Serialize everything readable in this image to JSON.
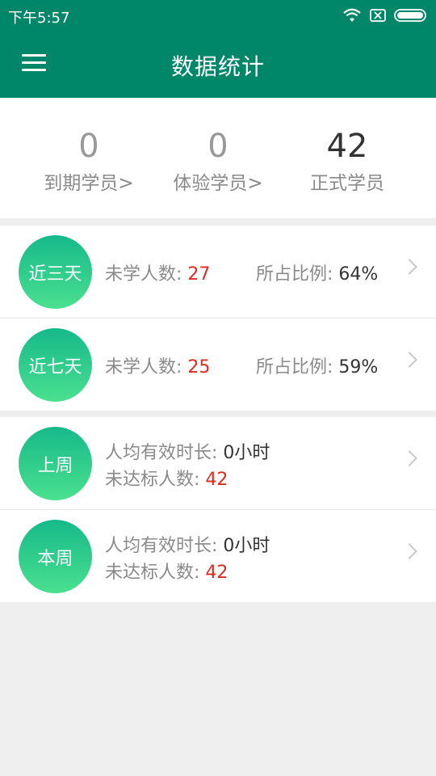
{
  "status_bar": {
    "time": "下午5:57",
    "icons": [
      "wifi-icon",
      "sim-disabled-icon",
      "battery-icon"
    ]
  },
  "app_bar": {
    "title": "数据统计",
    "menu_icon": "hamburger-menu-icon"
  },
  "summary": {
    "expired": {
      "count": "0",
      "label": "到期学员>"
    },
    "trial": {
      "count": "0",
      "label": "体验学员>"
    },
    "formal": {
      "count": "42",
      "label": "正式学员"
    }
  },
  "recent": [
    {
      "badge": "近三天",
      "unstudied_label": "未学人数: ",
      "unstudied_value": "27",
      "ratio_label": "所占比例: ",
      "ratio_value": "64%"
    },
    {
      "badge": "近七天",
      "unstudied_label": "未学人数: ",
      "unstudied_value": "25",
      "ratio_label": "所占比例: ",
      "ratio_value": "59%"
    }
  ],
  "weekly": [
    {
      "badge": "上周",
      "avg_label": "人均有效时长: ",
      "avg_value": "0小时",
      "unmet_label": "未达标人数: ",
      "unmet_value": "42"
    },
    {
      "badge": "本周",
      "avg_label": "人均有效时长: ",
      "avg_value": "0小时",
      "unmet_label": "未达标人数: ",
      "unmet_value": "42"
    }
  ],
  "colors": {
    "primary": "#00876a",
    "badge_gradient_top": "#16b98a",
    "badge_gradient_bottom": "#4ae08f",
    "alert_red": "#e02a1e",
    "background": "#efefef"
  }
}
